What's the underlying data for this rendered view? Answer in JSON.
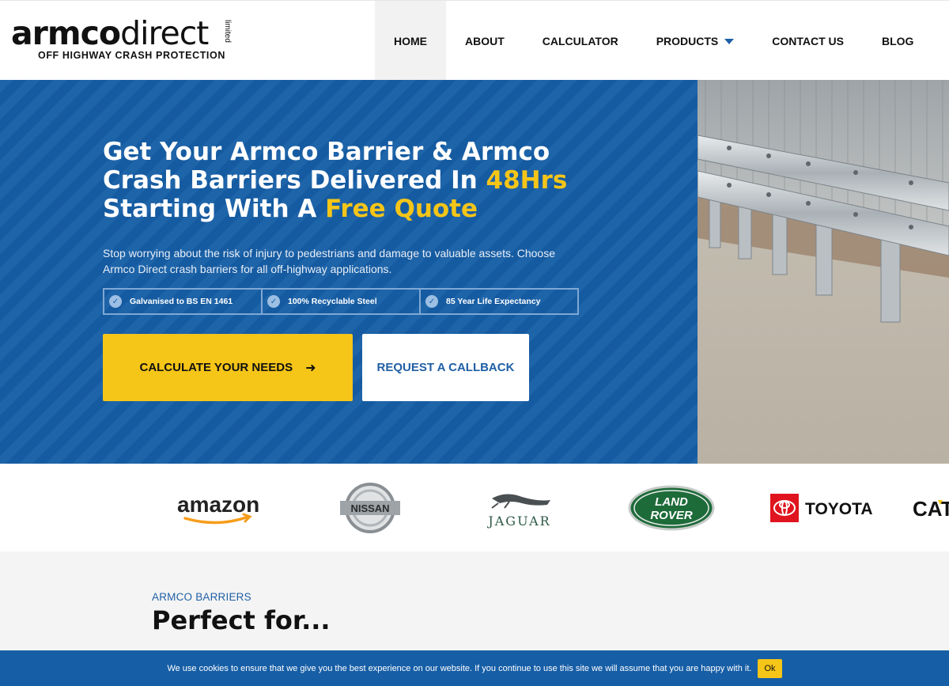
{
  "brand": {
    "logo_bold": "armco",
    "logo_light": "direct",
    "logo_limited": "limited",
    "tagline": "OFF HIGHWAY CRASH PROTECTION"
  },
  "nav": {
    "items": [
      {
        "label": "HOME"
      },
      {
        "label": "ABOUT"
      },
      {
        "label": "CALCULATOR"
      },
      {
        "label": "PRODUCTS"
      },
      {
        "label": "CONTACT US"
      },
      {
        "label": "BLOG"
      }
    ],
    "active": "HOME"
  },
  "hero": {
    "title_line1": "Get Your Armco Barrier & Armco",
    "title_line2_a": "Crash Barriers Delivered In ",
    "title_line2_b": "48Hrs",
    "title_line3_a": "Starting With A ",
    "title_line3_b": "Free Quote",
    "text": "Stop worrying about the risk of injury to pedestrians and damage to valuable assets. Choose Armco Direct crash barriers for all off-highway applications.",
    "badges": [
      {
        "label": "Galvanised to BS EN 1461"
      },
      {
        "label": "100% Recyclable Steel"
      },
      {
        "label": "85 Year Life Expectancy"
      }
    ],
    "btn_calculate": "CALCULATE YOUR NEEDS",
    "btn_callback": "REQUEST A CALLBACK"
  },
  "clients": {
    "logos": [
      {
        "name": "amazon",
        "icon": "amazon-logo"
      },
      {
        "name": "NISSAN",
        "icon": "nissan-logo"
      },
      {
        "name": "JAGUAR",
        "icon": "jaguar-logo"
      },
      {
        "name_line1": "LAND",
        "name_line2": "ROVER",
        "icon": "land-rover-logo"
      },
      {
        "name": "TOYOTA",
        "icon": "toyota-logo"
      },
      {
        "name": "CAT",
        "icon": "cat-logo"
      }
    ]
  },
  "section": {
    "kicker": "ARMCO BARRIERS",
    "title": "Perfect for..."
  },
  "cookie": {
    "text": "We use cookies to ensure that we give you the best experience on our website. If you continue to use this site we will assume that you are happy with it.",
    "ok": "Ok"
  },
  "colors": {
    "primary_blue": "#165ea6",
    "accent_yellow": "#f5c518",
    "land_rover_green": "#1e6b3a",
    "toyota_red": "#e0141e"
  }
}
